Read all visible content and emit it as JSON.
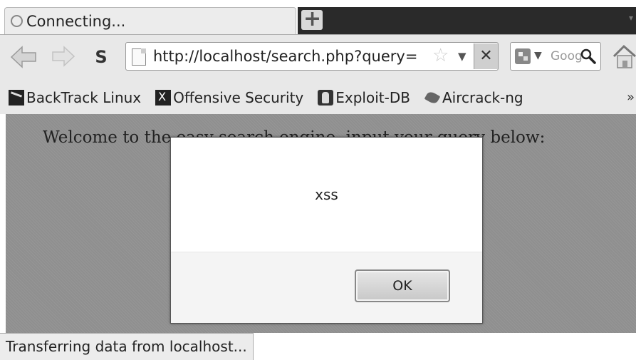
{
  "tab": {
    "title": "Connecting...",
    "new_tab_glyph": "+",
    "scroll_glyph": "▾"
  },
  "nav": {
    "stop_glyph": "✕",
    "sync_glyph": "S"
  },
  "urlbar": {
    "value": "http://localhost/search.php?query=",
    "dropdown_glyph": "▼",
    "star_glyph": "☆"
  },
  "searchbar": {
    "engine_dropdown_glyph": "▼",
    "placeholder": "Google"
  },
  "bookmarks": {
    "items": [
      {
        "label": "BackTrack Linux"
      },
      {
        "label": "Offensive Security"
      },
      {
        "label": "Exploit-DB"
      },
      {
        "label": "Aircrack-ng"
      }
    ],
    "more_glyph": "»"
  },
  "page": {
    "welcome_text": "Welcome to the easy search engine, input your query below:"
  },
  "dialog": {
    "message": "xss",
    "ok_label": "OK"
  },
  "status": {
    "text": "Transferring data from localhost..."
  }
}
